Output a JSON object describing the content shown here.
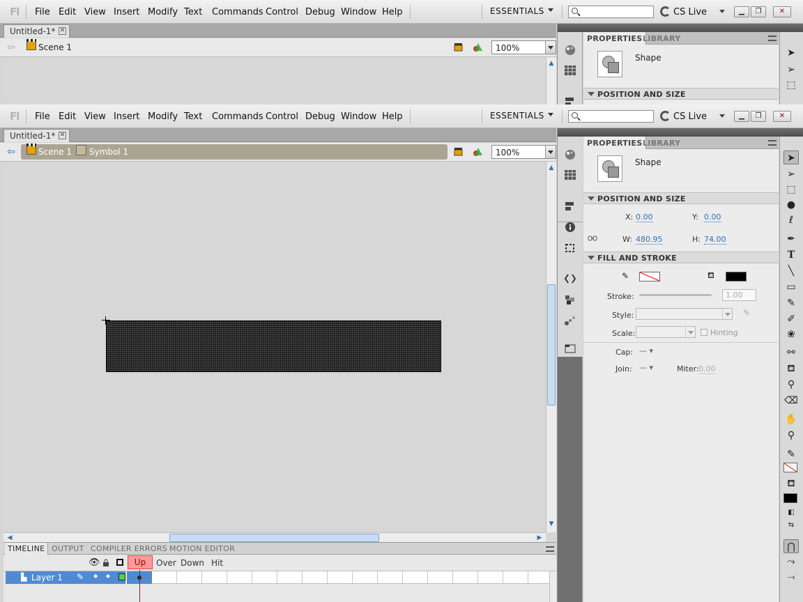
{
  "menus": [
    "File",
    "Edit",
    "View",
    "Insert",
    "Modify",
    "Text",
    "Commands",
    "Control",
    "Debug",
    "Window",
    "Help"
  ],
  "app_logo": "Fl",
  "workspace": "ESSENTIALS",
  "search_placeholder": "",
  "cs_live": "CS Live",
  "doc_tab": "Untitled-1*",
  "scene": "Scene 1",
  "symbol": "Symbol 1",
  "zoom": "100%",
  "timeline_tabs": [
    "TIMELINE",
    "OUTPUT",
    "COMPILER ERRORS",
    "MOTION EDITOR"
  ],
  "frame_labels": [
    "Up",
    "Over",
    "Down",
    "Hit"
  ],
  "layer_name": "Layer 1",
  "properties": {
    "tab_properties": "PROPERTIES",
    "tab_library": "LIBRARY",
    "object_type": "Shape",
    "section_position": "POSITION AND SIZE",
    "section_fill": "FILL AND STROKE",
    "x_label": "X:",
    "x_value": "0.00",
    "y_label": "Y:",
    "y_value": "0.00",
    "w_label": "W:",
    "w_value": "480.95",
    "h_label": "H:",
    "h_value": "74.00",
    "stroke_label": "Stroke:",
    "stroke_value": "1.00",
    "style_label": "Style:",
    "scale_label": "Scale:",
    "hinting_label": "Hinting",
    "cap_label": "Cap:",
    "join_label": "Join:",
    "miter_label": "Miter:",
    "miter_value": "0.00",
    "fill_color": "#000000",
    "stroke_color": "none"
  },
  "colors": {
    "accent": "#4f8ad3",
    "breadcrumb_active": "#aaa592",
    "up_frame": "#ff9a9a"
  }
}
